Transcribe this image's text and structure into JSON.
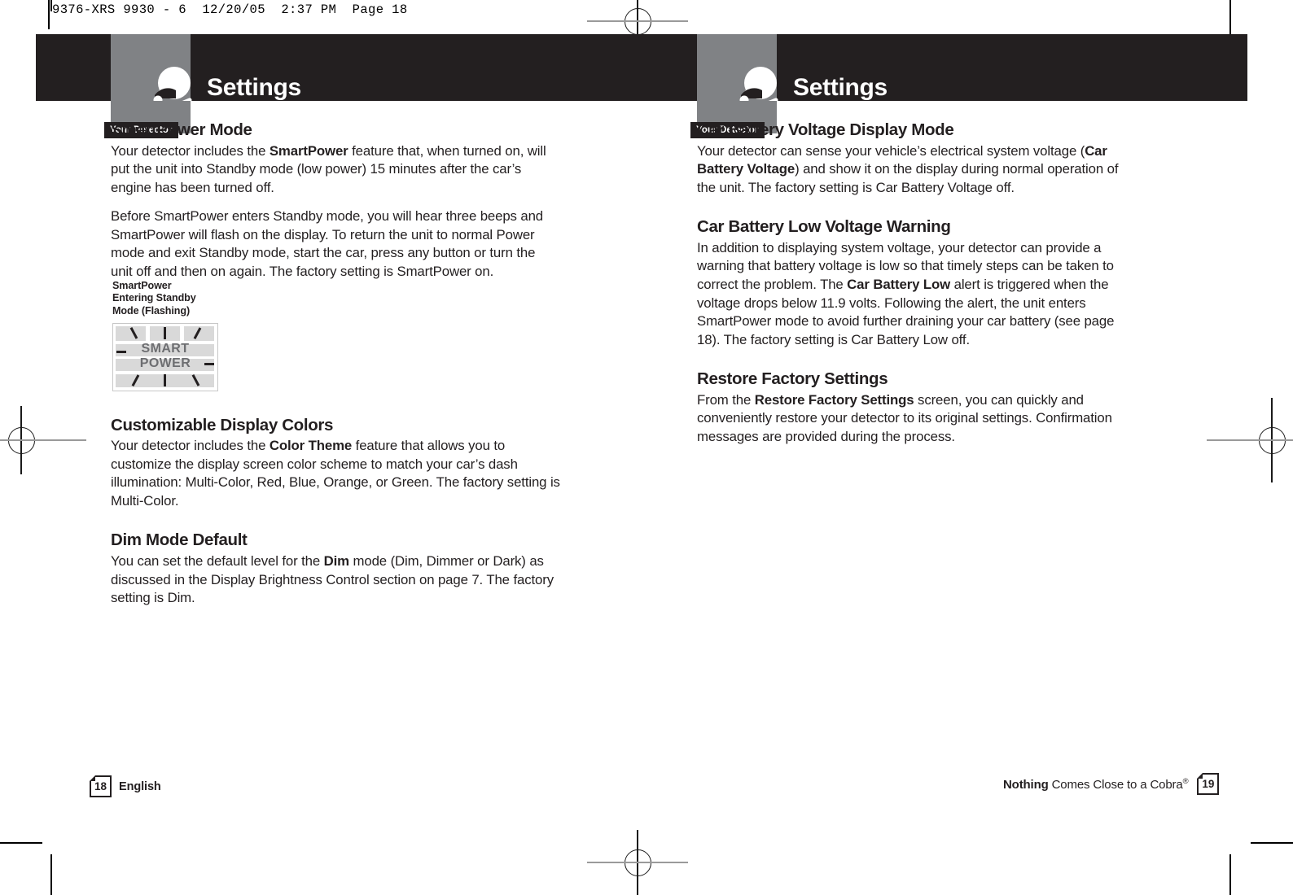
{
  "prepress": {
    "job_slug": "9376-XRS 9930 - 6  12/20/05  2:37 PM  Page 18"
  },
  "pages": [
    {
      "header": {
        "tag_label": "Your Detector",
        "title": "Settings",
        "icon": "radar-detector-icon"
      },
      "sections": [
        {
          "heading": "SmartPower Mode",
          "paragraphs": [
            "Your detector includes the <b>SmartPower</b> feature that, when turned on, will put the unit into Standby mode (low power) 15 minutes after the car’s engine has been turned off.",
            "Before SmartPower enters Standby mode, you will hear three beeps and SmartPower will flash on the display. To return the unit to normal Power mode and exit Standby mode, start the car, press any button or turn the unit off and then on again. The factory setting is SmartPower on."
          ]
        },
        {
          "heading": "Customizable Display Colors",
          "paragraphs": [
            "Your detector includes the <b>Color Theme</b> feature that allows you to customize the display screen color scheme to match your car’s dash illumination: Multi-Color, Red, Blue, Orange, or Green. The factory setting is Multi-Color."
          ]
        },
        {
          "heading": "Dim Mode Default",
          "paragraphs": [
            "You can set the default level for the <b>Dim</b> mode (Dim, Dimmer or Dark) as discussed in the Display Brightness Control section on page 7. The factory setting is Dim."
          ]
        }
      ],
      "figure": {
        "caption": "SmartPower\nEntering Standby\nMode (Flashing)",
        "display_line1": "SMART",
        "display_line2": "POWER"
      },
      "footer": {
        "page_number": "18",
        "label": "English"
      }
    },
    {
      "header": {
        "tag_label": "Your Detector",
        "title": "Settings",
        "icon": "radar-detector-icon"
      },
      "sections": [
        {
          "heading": "Car Battery Voltage Display Mode",
          "paragraphs": [
            "Your detector can sense your vehicle’s electrical system voltage (<b>Car Battery Voltage</b>) and show it on the display during normal operation of the unit. The factory setting is Car Battery Voltage off."
          ]
        },
        {
          "heading": "Car Battery Low Voltage Warning",
          "paragraphs": [
            "In addition to displaying system voltage, your detector can provide a warning that battery voltage is low so that timely steps can be taken to correct the problem. The <b>Car Battery Low</b> alert is triggered when the voltage drops below 11.9 volts. Following the alert, the unit enters SmartPower mode to avoid further draining your car battery (see page 18). The factory setting is Car Battery Low off."
          ]
        },
        {
          "heading": "Restore Factory Settings",
          "paragraphs": [
            "From the <b>Restore Factory Settings</b> screen, you can quickly and conveniently restore your detector to its original settings. Confirmation messages are provided during the process."
          ]
        }
      ],
      "footer": {
        "page_number": "19",
        "tagline_bold": "Nothing",
        "tagline_rest": " Comes Close to a Cobra",
        "tagline_mark": "®"
      }
    }
  ],
  "colors": {
    "ink": "#231f20",
    "gray_box": "#808285",
    "lcd_segment": "#d9d9d9",
    "lcd_text": "#6d6e71"
  }
}
